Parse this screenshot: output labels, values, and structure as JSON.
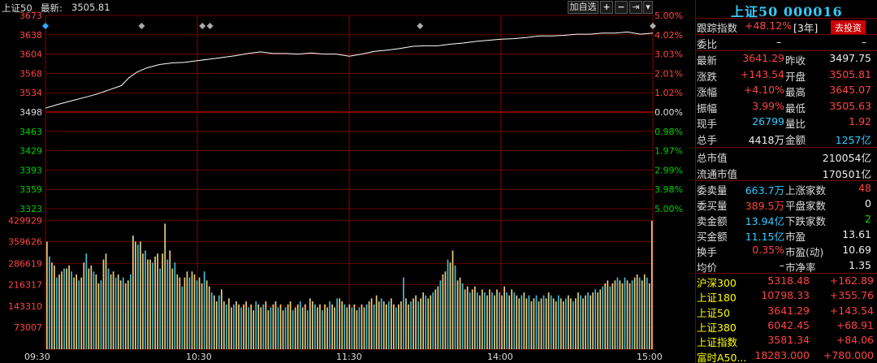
{
  "header": {
    "symbol": "上证50",
    "latest_label": "最新:",
    "latest_value": "3505.81",
    "add_watch": "加自选",
    "plus_btn": "+",
    "minus_btn": "−",
    "pin_btn": "⇥",
    "menu_btn": "▾"
  },
  "chart_data": {
    "type": "line",
    "price": {
      "prev_close": 3497.75,
      "y_ticks_left": [
        "3673",
        "3638",
        "3604",
        "3568",
        "3534",
        "3498",
        "3463",
        "3429",
        "3393",
        "3359",
        "3323"
      ],
      "y_ticks_right": [
        "5.00%",
        "4.02%",
        "3.03%",
        "2.01%",
        "1.02%",
        "0.00%",
        "0.98%",
        "1.97%",
        "2.99%",
        "3.98%",
        "5.00%"
      ],
      "ylim": [
        3323,
        3673
      ],
      "series": [
        {
          "x": 0,
          "y": 3505
        },
        {
          "x": 5,
          "y": 3512
        },
        {
          "x": 10,
          "y": 3518
        },
        {
          "x": 15,
          "y": 3524
        },
        {
          "x": 20,
          "y": 3530
        },
        {
          "x": 25,
          "y": 3538
        },
        {
          "x": 30,
          "y": 3546
        },
        {
          "x": 33,
          "y": 3560
        },
        {
          "x": 36,
          "y": 3570
        },
        {
          "x": 40,
          "y": 3578
        },
        {
          "x": 45,
          "y": 3584
        },
        {
          "x": 50,
          "y": 3587
        },
        {
          "x": 55,
          "y": 3588
        },
        {
          "x": 60,
          "y": 3591
        },
        {
          "x": 65,
          "y": 3594
        },
        {
          "x": 70,
          "y": 3597
        },
        {
          "x": 75,
          "y": 3600
        },
        {
          "x": 80,
          "y": 3604
        },
        {
          "x": 85,
          "y": 3607
        },
        {
          "x": 90,
          "y": 3604
        },
        {
          "x": 95,
          "y": 3604
        },
        {
          "x": 100,
          "y": 3603
        },
        {
          "x": 105,
          "y": 3605
        },
        {
          "x": 110,
          "y": 3603
        },
        {
          "x": 115,
          "y": 3603
        },
        {
          "x": 120,
          "y": 3599
        },
        {
          "x": 125,
          "y": 3603
        },
        {
          "x": 130,
          "y": 3608
        },
        {
          "x": 135,
          "y": 3610
        },
        {
          "x": 140,
          "y": 3613
        },
        {
          "x": 145,
          "y": 3617
        },
        {
          "x": 150,
          "y": 3618
        },
        {
          "x": 155,
          "y": 3618
        },
        {
          "x": 160,
          "y": 3621
        },
        {
          "x": 165,
          "y": 3623
        },
        {
          "x": 170,
          "y": 3626
        },
        {
          "x": 175,
          "y": 3628
        },
        {
          "x": 180,
          "y": 3630
        },
        {
          "x": 185,
          "y": 3631
        },
        {
          "x": 190,
          "y": 3633
        },
        {
          "x": 195,
          "y": 3636
        },
        {
          "x": 200,
          "y": 3636
        },
        {
          "x": 205,
          "y": 3637
        },
        {
          "x": 210,
          "y": 3639
        },
        {
          "x": 215,
          "y": 3639
        },
        {
          "x": 220,
          "y": 3641
        },
        {
          "x": 225,
          "y": 3641
        },
        {
          "x": 230,
          "y": 3643
        },
        {
          "x": 235,
          "y": 3639
        },
        {
          "x": 240,
          "y": 3641
        }
      ],
      "markers_x": [
        0,
        38,
        62,
        65,
        148,
        240
      ]
    },
    "volume": {
      "y_ticks": [
        "429929",
        "359626",
        "286619",
        "216317",
        "143310",
        "73007"
      ],
      "ylim": [
        0,
        470000
      ],
      "bars": [
        360000,
        310000,
        290000,
        280000,
        240000,
        250000,
        260000,
        270000,
        270000,
        280000,
        260000,
        240000,
        250000,
        230000,
        240000,
        290000,
        320000,
        270000,
        280000,
        260000,
        250000,
        220000,
        230000,
        300000,
        320000,
        270000,
        250000,
        260000,
        240000,
        250000,
        230000,
        240000,
        220000,
        230000,
        250000,
        380000,
        360000,
        350000,
        360000,
        320000,
        330000,
        300000,
        300000,
        290000,
        310000,
        320000,
        270000,
        320000,
        420000,
        300000,
        330000,
        270000,
        290000,
        250000,
        240000,
        210000,
        240000,
        260000,
        240000,
        260000,
        250000,
        230000,
        240000,
        220000,
        260000,
        230000,
        210000,
        190000,
        180000,
        160000,
        180000,
        200000,
        160000,
        150000,
        170000,
        140000,
        150000,
        160000,
        150000,
        140000,
        150000,
        160000,
        140000,
        150000,
        130000,
        160000,
        150000,
        140000,
        150000,
        160000,
        130000,
        140000,
        150000,
        160000,
        140000,
        150000,
        130000,
        140000,
        150000,
        160000,
        130000,
        140000,
        150000,
        160000,
        140000,
        150000,
        130000,
        170000,
        160000,
        150000,
        140000,
        150000,
        130000,
        150000,
        140000,
        160000,
        150000,
        140000,
        170000,
        170000,
        160000,
        150000,
        140000,
        150000,
        140000,
        150000,
        130000,
        140000,
        150000,
        140000,
        150000,
        160000,
        170000,
        150000,
        180000,
        160000,
        170000,
        160000,
        150000,
        160000,
        170000,
        150000,
        140000,
        150000,
        160000,
        240000,
        170000,
        150000,
        160000,
        170000,
        180000,
        160000,
        170000,
        190000,
        180000,
        170000,
        180000,
        190000,
        200000,
        210000,
        230000,
        250000,
        260000,
        300000,
        290000,
        330000,
        280000,
        230000,
        240000,
        220000,
        200000,
        210000,
        190000,
        200000,
        210000,
        190000,
        180000,
        200000,
        190000,
        180000,
        200000,
        190000,
        180000,
        200000,
        190000,
        180000,
        210000,
        190000,
        180000,
        200000,
        190000,
        180000,
        170000,
        180000,
        190000,
        170000,
        180000,
        160000,
        170000,
        180000,
        160000,
        170000,
        180000,
        170000,
        190000,
        180000,
        170000,
        160000,
        180000,
        170000,
        160000,
        170000,
        180000,
        170000,
        160000,
        170000,
        190000,
        180000,
        170000,
        180000,
        190000,
        180000,
        190000,
        200000,
        190000,
        200000,
        210000,
        220000,
        230000,
        210000,
        220000,
        230000,
        240000,
        230000,
        220000,
        240000,
        230000,
        220000,
        230000,
        240000,
        250000,
        240000,
        230000,
        250000,
        240000,
        220000,
        430000
      ],
      "colors": {
        "up": "#e8d080",
        "down": "#40c0d8"
      }
    },
    "x_ticks": [
      "09:30",
      "10:30",
      "11:30",
      "14:00",
      "15:00"
    ]
  },
  "panel": {
    "title": "上证50 000016",
    "track_label": "跟踪指数",
    "track_value": "+48.12%",
    "track_period": "[3年]",
    "invest_btn": "去投资",
    "weibi_label": "委比",
    "weibi_value": "–",
    "weibi_right": "–",
    "rows": [
      {
        "l1": "最新",
        "v1": "3641.29",
        "c1": "red",
        "l2": "昨收",
        "v2": "3497.75",
        "c2": "white"
      },
      {
        "l1": "涨跌",
        "v1": "+143.54",
        "c1": "red",
        "l2": "开盘",
        "v2": "3505.81",
        "c2": "red"
      },
      {
        "l1": "涨幅",
        "v1": "+4.10%",
        "c1": "red",
        "l2": "最高",
        "v2": "3645.07",
        "c2": "red"
      },
      {
        "l1": "振幅",
        "v1": "3.99%",
        "c1": "red",
        "l2": "最低",
        "v2": "3505.63",
        "c2": "red"
      },
      {
        "l1": "现手",
        "v1": "26799",
        "c1": "cyan",
        "l2": "量比",
        "v2": "1.92",
        "c2": "red"
      },
      {
        "l1": "总手",
        "v1": "4418万",
        "c1": "white",
        "l2": "金额",
        "v2": "1257亿",
        "c2": "cyan"
      }
    ],
    "cap_rows": [
      {
        "label": "总市值",
        "value": "210054亿"
      },
      {
        "label": "流通市值",
        "value": "170501亿"
      }
    ],
    "order_rows": [
      {
        "l1": "委卖量",
        "v1": "663.7万",
        "c1": "cyan",
        "l2": "上涨家数",
        "v2": "48",
        "c2": "red"
      },
      {
        "l1": "委买量",
        "v1": "389.5万",
        "c1": "red",
        "l2": "平盘家数",
        "v2": "0",
        "c2": "white"
      },
      {
        "l1": "卖金额",
        "v1": "13.94亿",
        "c1": "cyan",
        "l2": "下跌家数",
        "v2": "2",
        "c2": "green"
      },
      {
        "l1": "买金额",
        "v1": "11.15亿",
        "c1": "cyan",
        "l2": "市盈",
        "v2": "13.61",
        "c2": "white"
      },
      {
        "l1": "换手",
        "v1": "0.35%",
        "c1": "red",
        "l2": "市盈(动)",
        "v2": "10.69",
        "c2": "white"
      },
      {
        "l1": "均价",
        "v1": "–",
        "c1": "white",
        "l2": "市净率",
        "v2": "1.35",
        "c2": "white"
      }
    ],
    "indices": [
      {
        "name": "沪深300",
        "price": "5318.48",
        "chg": "+162.89"
      },
      {
        "name": "上证180",
        "price": "10798.33",
        "chg": "+355.76"
      },
      {
        "name": "上证50",
        "price": "3641.29",
        "chg": "+143.54"
      },
      {
        "name": "上证380",
        "price": "6042.45",
        "chg": "+68.91"
      },
      {
        "name": "上证指数",
        "price": "3581.34",
        "chg": "+84.06"
      },
      {
        "name": "富时A50...",
        "price": "18283.000",
        "chg": "+780.000"
      }
    ]
  }
}
